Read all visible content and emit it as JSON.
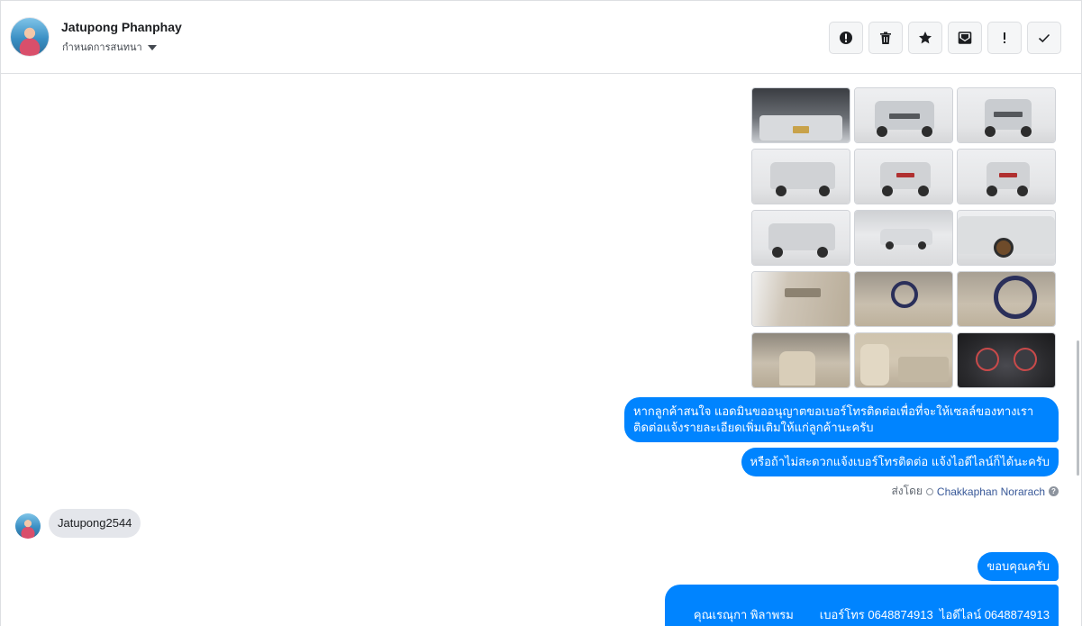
{
  "header": {
    "contact_name": "Jatupong Phanphay",
    "assign_label": "กำหนดการสนทนา"
  },
  "toolbar": {
    "buttons": [
      {
        "name": "spam-button",
        "icon": "alert-circle-icon"
      },
      {
        "name": "delete-button",
        "icon": "trash-icon"
      },
      {
        "name": "star-button",
        "icon": "star-icon"
      },
      {
        "name": "mark-unread-button",
        "icon": "envelope-icon"
      },
      {
        "name": "follow-up-button",
        "icon": "exclamation-icon"
      },
      {
        "name": "mark-done-button",
        "icon": "check-icon"
      }
    ]
  },
  "photos": [
    {
      "name": "engine-bay",
      "tone": "#bfc3c7"
    },
    {
      "name": "front-view",
      "tone": "#e9eaec"
    },
    {
      "name": "front-view-2",
      "tone": "#e9eaec"
    },
    {
      "name": "rear-three-quarter",
      "tone": "#e5e6e8"
    },
    {
      "name": "rear-view",
      "tone": "#e5e6e8"
    },
    {
      "name": "rear-view-2",
      "tone": "#e5e6e8"
    },
    {
      "name": "rear-side",
      "tone": "#e5e6e8"
    },
    {
      "name": "side-view-garage",
      "tone": "#dfe0e2"
    },
    {
      "name": "front-detail",
      "tone": "#e5e6e8"
    },
    {
      "name": "door-panel",
      "tone": "#cfc6b8"
    },
    {
      "name": "steering-interior",
      "tone": "#c9bfae"
    },
    {
      "name": "steering-closeup",
      "tone": "#c9bfae"
    },
    {
      "name": "seat-interior",
      "tone": "#c9bfae"
    },
    {
      "name": "rear-seat",
      "tone": "#d3c8b4"
    },
    {
      "name": "gauge-cluster",
      "tone": "#2a2a2d"
    }
  ],
  "messages": {
    "outgoing_1_line1": "หากลูกค้าสนใจ แอดมินขออนุญาตขอเบอร์โทรติดต่อเพื่อที่จะให้เซลล์ของทางเรา",
    "outgoing_1_line2": "ติดต่อแจ้งรายละเอียดเพิ่มเติมให้แก่ลูกค้านะครับ",
    "outgoing_2": "หรือถ้าไม่สะดวกแจ้งเบอร์โทรติดต่อ แจ้งไอดีไลน์ก็ได้นะครับ",
    "sent_by_label": "ส่งโดย",
    "sent_by_agent": "Chakkaphan Norarach",
    "incoming_1": "Jatupong2544",
    "outgoing_3": "ขอบคุณครับ",
    "outgoing_4": "คุณเรณุกา พิลาพรม        เบอร์โทร 0648874913  ไอดีไลน์ 0648874913"
  },
  "colors": {
    "outgoing_bubble": "#0084ff",
    "incoming_bubble": "#e4e6eb",
    "agent_link": "#385898"
  }
}
